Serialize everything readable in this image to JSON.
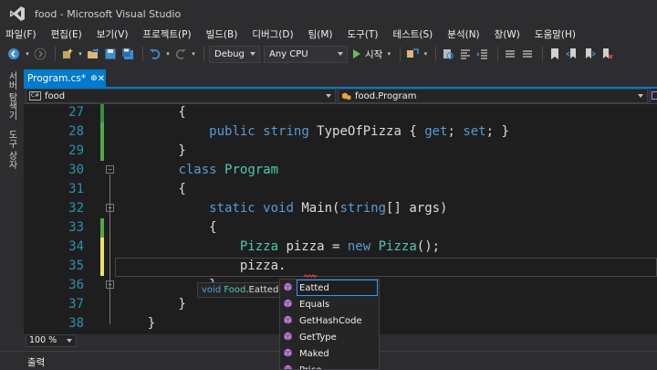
{
  "window": {
    "title": "food - Microsoft Visual Studio"
  },
  "menu": [
    "파일(F)",
    "편집(E)",
    "보기(V)",
    "프로젝트(P)",
    "빌드(B)",
    "디버그(D)",
    "팀(M)",
    "도구(T)",
    "테스트(S)",
    "분석(N)",
    "창(W)",
    "도움말(H)"
  ],
  "toolbar": {
    "config": "Debug",
    "platform": "Any CPU",
    "start_label": "시작"
  },
  "sidebar": {
    "server_explorer": "서버 탐색기",
    "toolbox": "도구 상자"
  },
  "tab": {
    "label": "Program.cs*",
    "pin": "⊕",
    "close": "✕"
  },
  "nav": {
    "project": "food",
    "scope": "food.Program"
  },
  "editor": {
    "lines": [
      {
        "n": "27",
        "code": [
          {
            "t": "        {",
            "c": "id"
          }
        ]
      },
      {
        "n": "28",
        "code": [
          {
            "t": "            ",
            "c": "id"
          },
          {
            "t": "public",
            "c": "kw"
          },
          {
            "t": " ",
            "c": "id"
          },
          {
            "t": "string",
            "c": "kw"
          },
          {
            "t": " TypeOfPizza { ",
            "c": "id"
          },
          {
            "t": "get",
            "c": "kw"
          },
          {
            "t": "; ",
            "c": "id"
          },
          {
            "t": "set",
            "c": "kw"
          },
          {
            "t": "; }",
            "c": "id"
          }
        ]
      },
      {
        "n": "29",
        "code": [
          {
            "t": "        }",
            "c": "id"
          }
        ]
      },
      {
        "n": "30",
        "code": [
          {
            "t": "        ",
            "c": "id"
          },
          {
            "t": "class",
            "c": "kw"
          },
          {
            "t": " ",
            "c": "id"
          },
          {
            "t": "Program",
            "c": "ty"
          }
        ]
      },
      {
        "n": "31",
        "code": [
          {
            "t": "        {",
            "c": "id"
          }
        ]
      },
      {
        "n": "32",
        "code": [
          {
            "t": "            ",
            "c": "id"
          },
          {
            "t": "static",
            "c": "kw"
          },
          {
            "t": " ",
            "c": "id"
          },
          {
            "t": "void",
            "c": "kw"
          },
          {
            "t": " Main(",
            "c": "id"
          },
          {
            "t": "string",
            "c": "kw"
          },
          {
            "t": "[] args)",
            "c": "id"
          }
        ]
      },
      {
        "n": "33",
        "code": [
          {
            "t": "            {",
            "c": "id"
          }
        ]
      },
      {
        "n": "34",
        "code": [
          {
            "t": "                ",
            "c": "id"
          },
          {
            "t": "Pizza",
            "c": "ty"
          },
          {
            "t": " pizza = ",
            "c": "id"
          },
          {
            "t": "new",
            "c": "kw"
          },
          {
            "t": " ",
            "c": "id"
          },
          {
            "t": "Pizza",
            "c": "ty"
          },
          {
            "t": "();",
            "c": "id"
          }
        ]
      },
      {
        "n": "35",
        "code": [
          {
            "t": "                pizza.",
            "c": "id"
          }
        ]
      },
      {
        "n": "36",
        "code": [
          {
            "t": "            }",
            "c": "id"
          }
        ]
      },
      {
        "n": "37",
        "code": [
          {
            "t": "        }",
            "c": "id"
          }
        ]
      },
      {
        "n": "38",
        "code": [
          {
            "t": "    }",
            "c": "id"
          }
        ]
      }
    ]
  },
  "tooltip": {
    "kw": "void",
    "cls": "Food",
    "rest": ".Eatted()"
  },
  "intellisense": {
    "items": [
      "Eatted",
      "Equals",
      "GetHashCode",
      "GetType",
      "Maked",
      "Price"
    ],
    "selected": 0
  },
  "status": {
    "zoom": "100 %"
  },
  "output": {
    "label": "출력"
  },
  "colors": {
    "accent": "#007acc",
    "keyword": "#569cd6",
    "type": "#4ec9b0",
    "linenum": "#2b91af"
  }
}
